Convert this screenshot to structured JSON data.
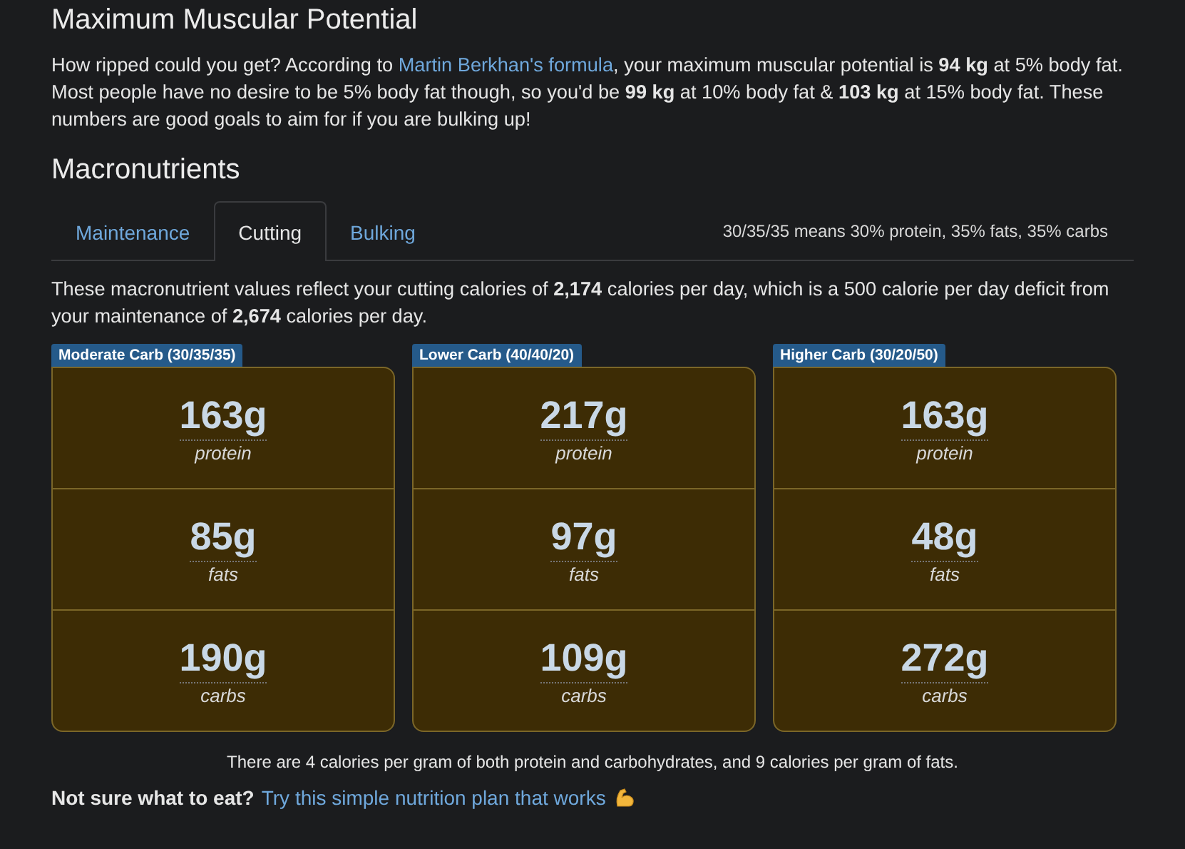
{
  "potential": {
    "title": "Maximum Muscular Potential",
    "before": "How ripped could you get? According to ",
    "link": "Martin Berkhan's formula",
    "after": ", your maximum muscular potential is **94 kg** at 5% body fat. Most people have no desire to be 5% body fat though, so you'd be **99 kg** at 10% body fat & **103 kg** at 15% body fat. These numbers are good goals to aim for if you are bulking up!"
  },
  "macros": {
    "title": "Macronutrients",
    "tabs": [
      {
        "label": "Maintenance",
        "selected": false
      },
      {
        "label": "Cutting",
        "selected": true
      },
      {
        "label": "Bulking",
        "selected": false
      }
    ],
    "legend": "30/35/35 means 30% protein, 35% fats, 35% carbs",
    "summary": "These macronutrient values reflect your cutting calories of **2,174** calories per day, which is a 500 calorie per day deficit from your maintenance of **2,674** calories per day.",
    "plans": [
      {
        "label": "Moderate Carb (30/35/35)",
        "items": [
          {
            "amount": "163g",
            "name": "protein"
          },
          {
            "amount": "85g",
            "name": "fats"
          },
          {
            "amount": "190g",
            "name": "carbs"
          }
        ]
      },
      {
        "label": "Lower Carb (40/40/20)",
        "items": [
          {
            "amount": "217g",
            "name": "protein"
          },
          {
            "amount": "97g",
            "name": "fats"
          },
          {
            "amount": "109g",
            "name": "carbs"
          }
        ]
      },
      {
        "label": "Higher Carb (30/20/50)",
        "items": [
          {
            "amount": "163g",
            "name": "protein"
          },
          {
            "amount": "48g",
            "name": "fats"
          },
          {
            "amount": "272g",
            "name": "carbs"
          }
        ]
      }
    ],
    "note": "There are 4 calories per gram of both protein and carbohydrates, and 9 calories per gram of fats.",
    "cta_question": "Not sure what to eat?",
    "cta_link": "Try this simple nutrition plan that works"
  }
}
